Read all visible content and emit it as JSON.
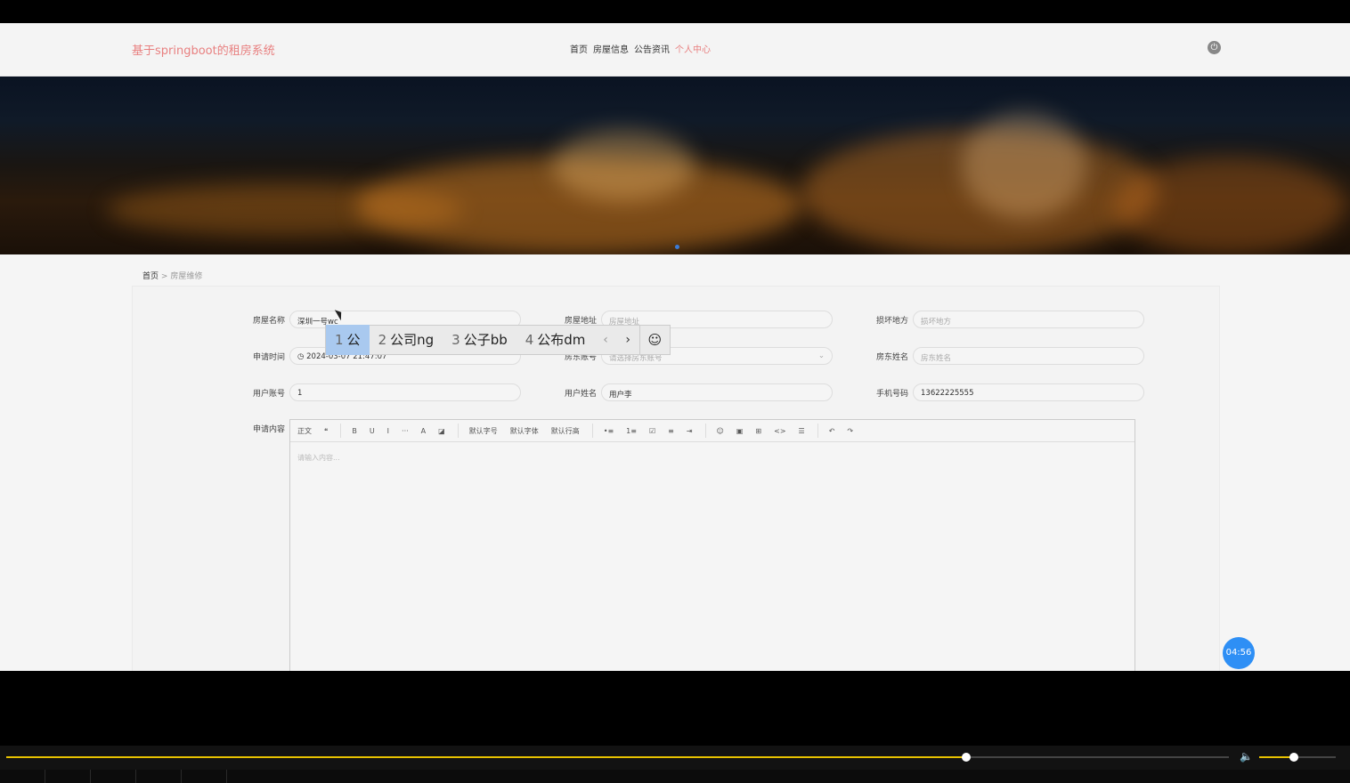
{
  "header": {
    "site_title": "基于springboot的租房系统",
    "nav": [
      "首页",
      "房屋信息",
      "公告资讯",
      "个人中心"
    ],
    "active_nav": "个人中心"
  },
  "breadcrumb": {
    "home": "首页",
    "sep": ">",
    "current": "房屋维修"
  },
  "form": {
    "fields": [
      {
        "label": "房屋名称",
        "value": "深圳一号wc",
        "placeholder": ""
      },
      {
        "label": "房屋地址",
        "value": "",
        "placeholder": "房屋地址"
      },
      {
        "label": "损坏地方",
        "value": "",
        "placeholder": "损坏地方"
      },
      {
        "label": "申请时间",
        "value": "2024-03-07 21:47:07",
        "placeholder": ""
      },
      {
        "label": "房东账号",
        "value": "",
        "placeholder": "请选择房东账号"
      },
      {
        "label": "房东姓名",
        "value": "",
        "placeholder": "房东姓名"
      },
      {
        "label": "用户账号",
        "value": "1",
        "placeholder": ""
      },
      {
        "label": "用户姓名",
        "value": "用户李",
        "placeholder": ""
      },
      {
        "label": "手机号码",
        "value": "13622225555",
        "placeholder": ""
      }
    ],
    "content_label": "申请内容",
    "editor_placeholder": "请输入内容...",
    "toolbar": [
      "正文",
      "❝",
      "B",
      "U",
      "I",
      "···",
      "A",
      "◪",
      "默认字号",
      "默认字体",
      "默认行高",
      "•≡",
      "1≡",
      "☑",
      "≡",
      "⇥",
      "☺",
      "▣",
      "⊞",
      "<>",
      "☰",
      "↶",
      "↷"
    ]
  },
  "ime": {
    "candidates": [
      {
        "num": "1",
        "text": "公"
      },
      {
        "num": "2",
        "text": "公司ng"
      },
      {
        "num": "3",
        "text": "公子bb"
      },
      {
        "num": "4",
        "text": "公布dm"
      }
    ],
    "prev": "‹",
    "next": "›",
    "emoji": "☺"
  },
  "timer": "04:56",
  "player": {
    "progress": 0.785,
    "volume": 0.45
  },
  "colors": {
    "accent": "#e88080",
    "timer": "#2e8ff5",
    "seek": "#e8c200"
  }
}
